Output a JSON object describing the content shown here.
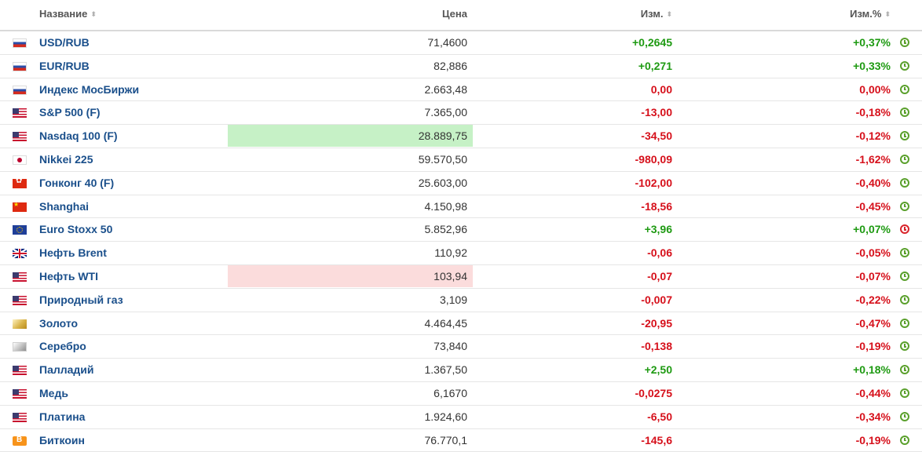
{
  "header": {
    "name": "Название",
    "price": "Цена",
    "change": "Изм.",
    "change_pct": "Изм.%",
    "sort_glyph": "⬍"
  },
  "colors": {
    "up": "#1e9a12",
    "down": "#d6101b",
    "link": "#1a4f8b",
    "highlight_up": "#c6f1c6",
    "highlight_down": "#fbdcdc",
    "market_open": "#5aa02c",
    "market_closed": "#d9242b"
  },
  "rows": [
    {
      "flag": "ru",
      "name": "USD/RUB",
      "price": "71,4600",
      "change": "+0,2645",
      "change_pct": "+0,37%",
      "dir": "up",
      "highlight": "",
      "market": "open"
    },
    {
      "flag": "ru",
      "name": "EUR/RUB",
      "price": "82,886",
      "change": "+0,271",
      "change_pct": "+0,33%",
      "dir": "up",
      "highlight": "",
      "market": "open"
    },
    {
      "flag": "ru",
      "name": "Индекс МосБиржи",
      "price": "2.663,48",
      "change": "0,00",
      "change_pct": "0,00%",
      "dir": "flat",
      "highlight": "",
      "market": "open"
    },
    {
      "flag": "us",
      "name": "S&P 500 (F)",
      "price": "7.365,00",
      "change": "-13,00",
      "change_pct": "-0,18%",
      "dir": "down",
      "highlight": "",
      "market": "open"
    },
    {
      "flag": "us",
      "name": "Nasdaq 100 (F)",
      "price": "28.889,75",
      "change": "-34,50",
      "change_pct": "-0,12%",
      "dir": "down",
      "highlight": "up",
      "market": "open"
    },
    {
      "flag": "jp",
      "name": "Nikkei 225",
      "price": "59.570,50",
      "change": "-980,09",
      "change_pct": "-1,62%",
      "dir": "down",
      "highlight": "",
      "market": "open"
    },
    {
      "flag": "hk",
      "name": "Гонконг 40 (F)",
      "price": "25.603,00",
      "change": "-102,00",
      "change_pct": "-0,40%",
      "dir": "down",
      "highlight": "",
      "market": "open"
    },
    {
      "flag": "cn",
      "name": "Shanghai",
      "price": "4.150,98",
      "change": "-18,56",
      "change_pct": "-0,45%",
      "dir": "down",
      "highlight": "",
      "market": "open"
    },
    {
      "flag": "eu",
      "name": "Euro Stoxx 50",
      "price": "5.852,96",
      "change": "+3,96",
      "change_pct": "+0,07%",
      "dir": "up",
      "highlight": "",
      "market": "closed"
    },
    {
      "flag": "gb",
      "name": "Нефть Brent",
      "price": "110,92",
      "change": "-0,06",
      "change_pct": "-0,05%",
      "dir": "down",
      "highlight": "",
      "market": "open"
    },
    {
      "flag": "us",
      "name": "Нефть WTI",
      "price": "103,94",
      "change": "-0,07",
      "change_pct": "-0,07%",
      "dir": "down",
      "highlight": "down",
      "market": "open"
    },
    {
      "flag": "us",
      "name": "Природный газ",
      "price": "3,109",
      "change": "-0,007",
      "change_pct": "-0,22%",
      "dir": "down",
      "highlight": "",
      "market": "open"
    },
    {
      "flag": "gold",
      "name": "Золото",
      "price": "4.464,45",
      "change": "-20,95",
      "change_pct": "-0,47%",
      "dir": "down",
      "highlight": "",
      "market": "open"
    },
    {
      "flag": "silver",
      "name": "Серебро",
      "price": "73,840",
      "change": "-0,138",
      "change_pct": "-0,19%",
      "dir": "down",
      "highlight": "",
      "market": "open"
    },
    {
      "flag": "us",
      "name": "Палладий",
      "price": "1.367,50",
      "change": "+2,50",
      "change_pct": "+0,18%",
      "dir": "up",
      "highlight": "",
      "market": "open"
    },
    {
      "flag": "us",
      "name": "Медь",
      "price": "6,1670",
      "change": "-0,0275",
      "change_pct": "-0,44%",
      "dir": "down",
      "highlight": "",
      "market": "open"
    },
    {
      "flag": "us",
      "name": "Платина",
      "price": "1.924,60",
      "change": "-6,50",
      "change_pct": "-0,34%",
      "dir": "down",
      "highlight": "",
      "market": "open"
    },
    {
      "flag": "btc",
      "name": "Биткоин",
      "price": "76.770,1",
      "change": "-145,6",
      "change_pct": "-0,19%",
      "dir": "down",
      "highlight": "",
      "market": "open"
    }
  ]
}
